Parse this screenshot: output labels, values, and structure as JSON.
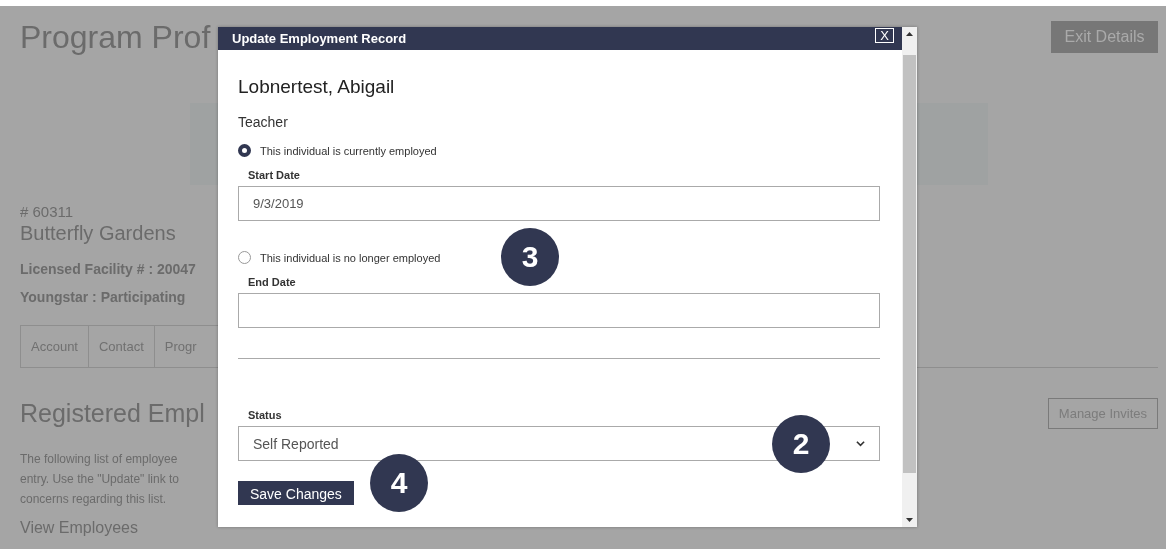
{
  "page": {
    "title": "Program Prof",
    "exit_button": "Exit Details",
    "program_number": "# 60311",
    "program_name": "Butterfly Gardens",
    "facts": [
      "Licensed Facility # : 20047",
      "Youngstar : Participating"
    ],
    "tabs": [
      {
        "label": "Account",
        "selected": false
      },
      {
        "label": "Contact",
        "selected": false
      },
      {
        "label": "Progr",
        "selected": false
      }
    ],
    "section_title": "Registered Empl",
    "description_lines": [
      "The following list of employee",
      "entry. Use the \"Update\" link to",
      "concerns regarding this list."
    ],
    "view_link": "View Employees",
    "manage_button": "Manage Invites"
  },
  "modal": {
    "title": "Update Employment Record",
    "close": "X",
    "person": "Lobnertest, Abigail",
    "role": "Teacher",
    "options": [
      {
        "label": "This individual is currently employed",
        "selected": true,
        "date_label": "Start Date",
        "date_value": "9/3/2019"
      },
      {
        "label": "This individual is no longer employed",
        "selected": false,
        "date_label": "End Date",
        "callout": "3"
      }
    ],
    "status": {
      "label": "Status",
      "value": "Self Reported",
      "callout": "2"
    },
    "save_button": "Save Changes",
    "save_callout": "4"
  }
}
